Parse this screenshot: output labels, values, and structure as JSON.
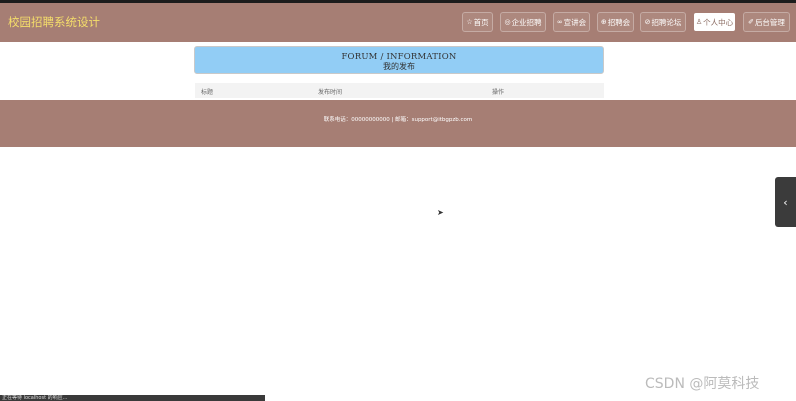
{
  "app": {
    "brand": "校园招聘系统设计"
  },
  "nav": {
    "items": [
      {
        "icon": "☆",
        "label": "首页"
      },
      {
        "icon": "◎",
        "label": "企业招聘"
      },
      {
        "icon": "∞",
        "label": "宣讲会"
      },
      {
        "icon": "⊕",
        "label": "招聘会"
      },
      {
        "icon": "⊘",
        "label": "招聘论坛"
      },
      {
        "icon": "♙",
        "label": "个人中心"
      },
      {
        "icon": "✐",
        "label": "后台管理"
      }
    ],
    "active_index": 5
  },
  "section": {
    "title": "FORUM / INFORMATION",
    "subtitle": "我的发布"
  },
  "table": {
    "columns": [
      "标题",
      "发布时间",
      "操作"
    ]
  },
  "footer": {
    "text": "联系电话：00000000000 | 邮箱：support@itbgpzb.com"
  },
  "side": {
    "toggle_glyph": "‹"
  },
  "status": {
    "text": "正在等待 localhost 的响应..."
  },
  "watermark": "CSDN @阿莫科技",
  "colors": {
    "brand_bar": "#a67e74",
    "brand_text": "#f5de6a",
    "header_box": "#92cdf5"
  }
}
